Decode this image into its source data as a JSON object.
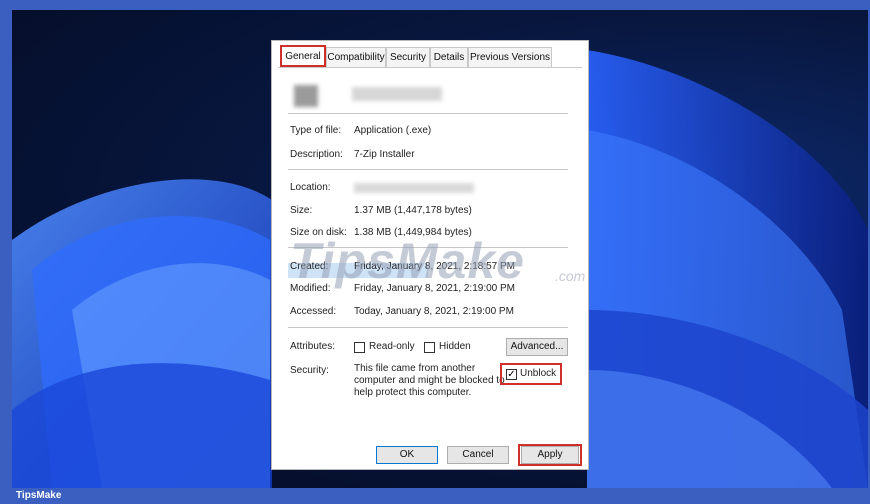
{
  "footer": {
    "brand": "TipsMake"
  },
  "watermark": {
    "text": "TipsMake",
    "suffix": ".com"
  },
  "dialog": {
    "tabs": [
      "General",
      "Compatibility",
      "Security",
      "Details",
      "Previous Versions"
    ],
    "active_tab": "General",
    "type_of_file": {
      "label": "Type of file:",
      "value": "Application (.exe)"
    },
    "description": {
      "label": "Description:",
      "value": "7-Zip Installer"
    },
    "location": {
      "label": "Location:"
    },
    "size": {
      "label": "Size:",
      "value": "1.37 MB (1,447,178 bytes)"
    },
    "size_on_disk": {
      "label": "Size on disk:",
      "value": "1.38 MB (1,449,984 bytes)"
    },
    "created": {
      "label": "Created:",
      "value": "Friday, January 8, 2021, 2:18:57 PM"
    },
    "modified": {
      "label": "Modified:",
      "value": "Friday, January 8, 2021, 2:19:00 PM"
    },
    "accessed": {
      "label": "Accessed:",
      "value": "Today, January 8, 2021, 2:19:00 PM"
    },
    "attributes": {
      "label": "Attributes:",
      "read_only": {
        "label": "Read-only",
        "checked": false
      },
      "hidden": {
        "label": "Hidden",
        "checked": false
      },
      "advanced_button": "Advanced..."
    },
    "security": {
      "label": "Security:",
      "line1": "This file came from another",
      "line2": "computer and might be blocked to",
      "line3": "help protect this computer.",
      "unblock": {
        "label": "Unblock",
        "checked": true
      }
    },
    "buttons": {
      "ok": "OK",
      "cancel": "Cancel",
      "apply": "Apply"
    }
  },
  "colors": {
    "highlight_red": "#d0302a",
    "frame_blue": "#3a5fc0",
    "selection": "#cfe3f6"
  }
}
